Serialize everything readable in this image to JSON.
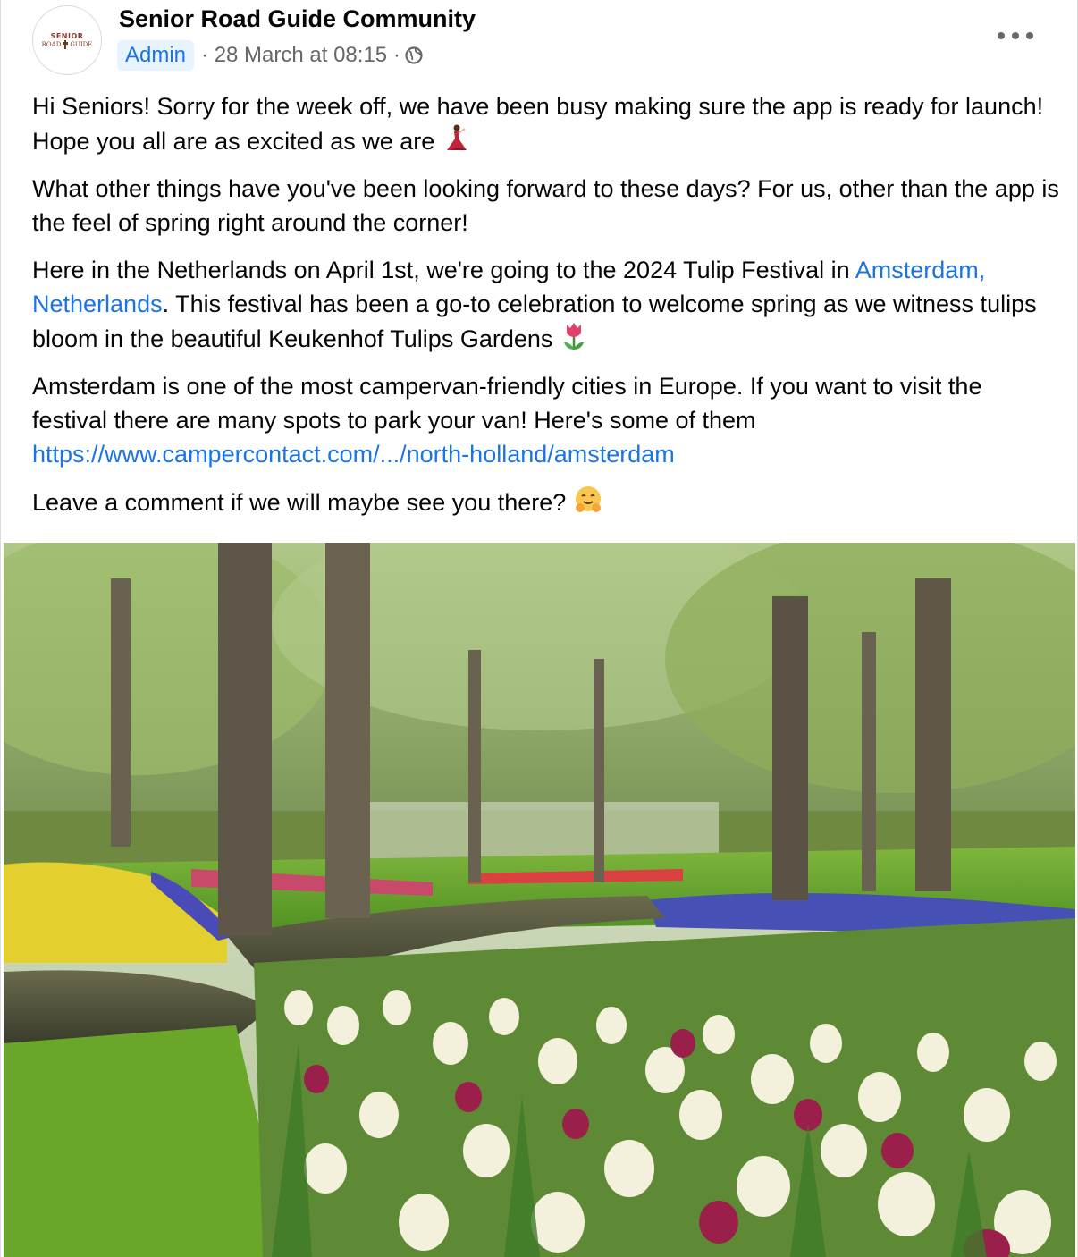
{
  "post": {
    "group_name": "Senior Road Guide Community",
    "avatar": {
      "line1": "SENIOR",
      "line2a": "ROAD",
      "line2b": "GUIDE"
    },
    "badge": "Admin",
    "meta": "· 28 March at 08:15 ·",
    "more_icon": "more-options-icon",
    "privacy_icon": "globe-icon"
  },
  "body": {
    "p1": "Hi Seniors! Sorry for the week off, we have been busy making sure the app is ready for launch! Hope you all are as excited as we are",
    "p2": "What other things have you've been looking forward to these days? For us, other than the app is the feel of spring right around the corner!",
    "p3_before": "Here in the Netherlands on April 1st, we're going to the 2024 Tulip Festival in ",
    "p3_link": "Amsterdam, Netherlands",
    "p3_after": ". This festival has been a go-to celebration to welcome spring as we witness tulips bloom in the beautiful Keukenhof Tulips Gardens",
    "p4": "Amsterdam is one of the most campervan-friendly cities in Europe. If you want to visit the festival there are many spots to park your van! Here's some of them",
    "p4_link": "https://www.campercontact.com/.../north-holland/amsterdam",
    "p5": "Leave a comment if we will maybe see you there?"
  },
  "emojis": [
    "dancer-emoji",
    "tulip-emoji",
    "hugging-face-emoji"
  ],
  "colors": {
    "link": "#1b74e4",
    "badge_bg": "#e7f3ff",
    "meta": "#65676b"
  }
}
